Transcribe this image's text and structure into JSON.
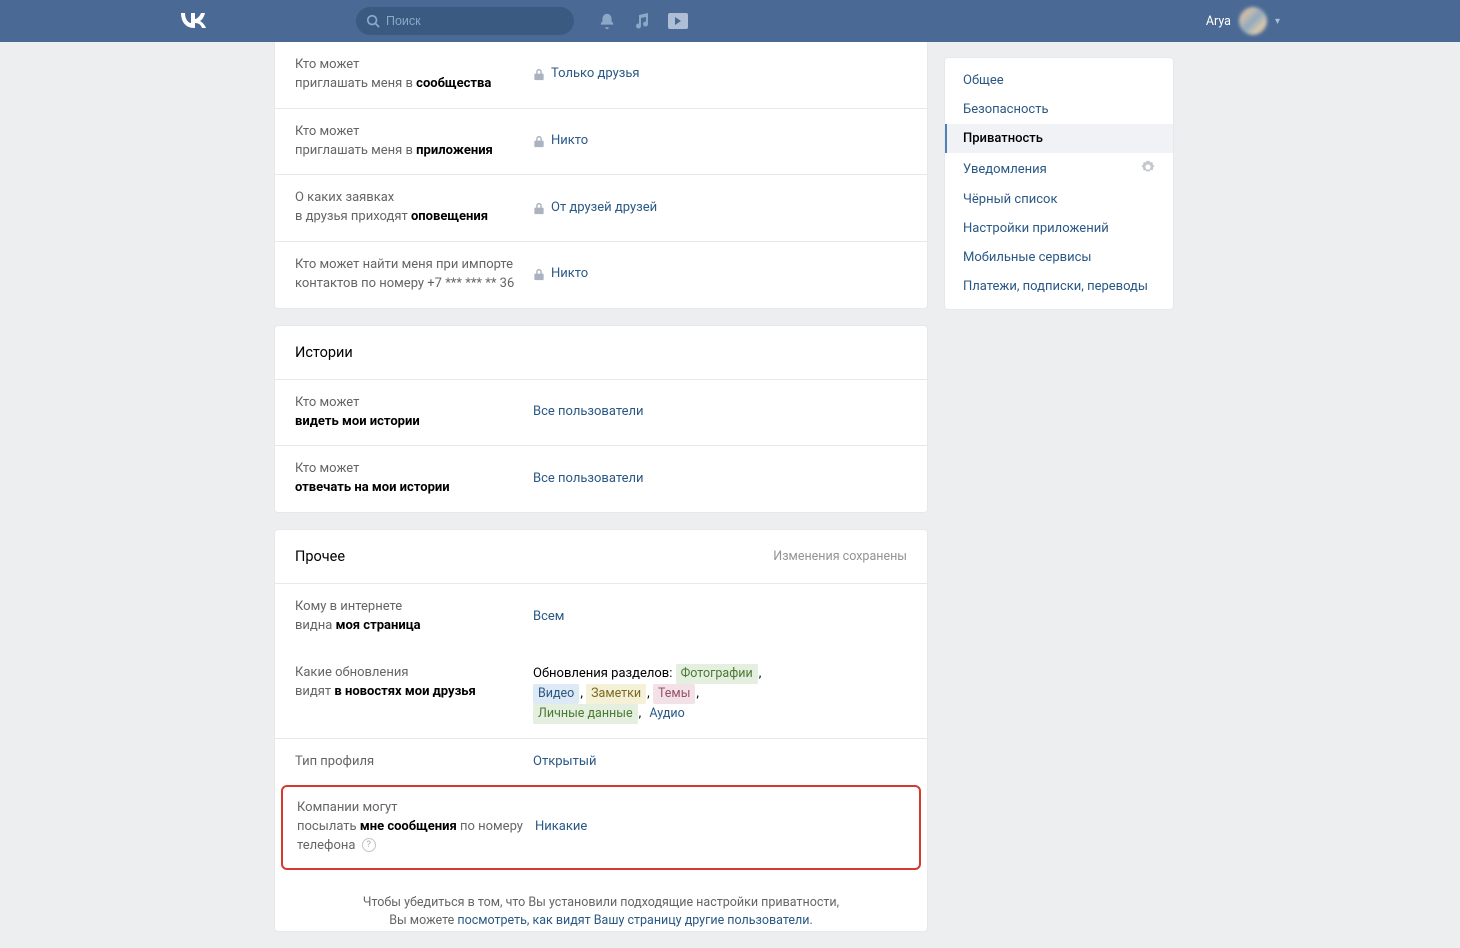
{
  "header": {
    "search_placeholder": "Поиск",
    "username": "Arya"
  },
  "aside": {
    "items": [
      {
        "label": "Общее"
      },
      {
        "label": "Безопасность"
      },
      {
        "label": "Приватность"
      },
      {
        "label": "Уведомления",
        "gear": true
      },
      {
        "label": "Чёрный список"
      },
      {
        "label": "Настройки приложений"
      },
      {
        "label": "Мобильные сервисы"
      },
      {
        "label": "Платежи, подписки, переводы"
      }
    ],
    "active_index": 2
  },
  "section_top": {
    "rows": [
      {
        "l1": "Кто может",
        "l2_pre": "приглашать меня в ",
        "l2_b": "сообщества",
        "lock": true,
        "val": "Только друзья"
      },
      {
        "l1": "Кто может",
        "l2_pre": "приглашать меня в ",
        "l2_b": "приложения",
        "lock": true,
        "val": "Никто"
      },
      {
        "l1": "О каких заявках",
        "l2_pre": "в друзья приходят ",
        "l2_b": "оповещения",
        "lock": true,
        "val": "От друзей друзей"
      },
      {
        "l1": "Кто может найти меня при импорте",
        "l2_pre": "контактов по номеру +7 *** *** ** 36",
        "l2_b": "",
        "lock": true,
        "val": "Никто"
      }
    ]
  },
  "section_stories": {
    "title": "Истории",
    "rows": [
      {
        "l1": "Кто может",
        "l2_b": "видеть мои истории",
        "val": "Все пользователи"
      },
      {
        "l1": "Кто может",
        "l2_b": "отвечать на мои истории",
        "val": "Все пользователи"
      }
    ]
  },
  "section_other": {
    "title": "Прочее",
    "saved": "Изменения сохранены",
    "rows_a": [
      {
        "l1": "Кому в интернете",
        "l2_pre": "видна ",
        "l2_b": "моя страница",
        "val": "Всем"
      }
    ],
    "updates": {
      "l1": "Какие обновления",
      "l2_pre": "видят ",
      "l2_b": "в новостях мои друзья",
      "lead": "Обновления разделов: ",
      "tags": [
        {
          "t": "Фотографии",
          "cls": "tag-green"
        },
        {
          "t": "Видео",
          "cls": "tag-blue"
        },
        {
          "t": "Заметки",
          "cls": "tag-yel"
        },
        {
          "t": "Темы",
          "cls": "tag-pink"
        },
        {
          "t": "Личные данные",
          "cls": "tag-green"
        },
        {
          "t": "Аудио",
          "cls": "tag-plain"
        }
      ]
    },
    "rows_b": [
      {
        "l1": "Тип профиля",
        "l2_b": "",
        "val": "Открытый"
      }
    ],
    "highlight": {
      "l1": "Компании могут",
      "l2_pre": "посылать ",
      "l2_b": "мне сообщения",
      "l2_post": " по номеру телефона",
      "help": true,
      "val": "Никакие"
    }
  },
  "footnote": {
    "t1": "Чтобы убедиться в том, что Вы установили подходящие настройки приватности,",
    "t2a": "Вы можете ",
    "t2b": "посмотреть, как видят Вашу страницу другие пользователи."
  }
}
